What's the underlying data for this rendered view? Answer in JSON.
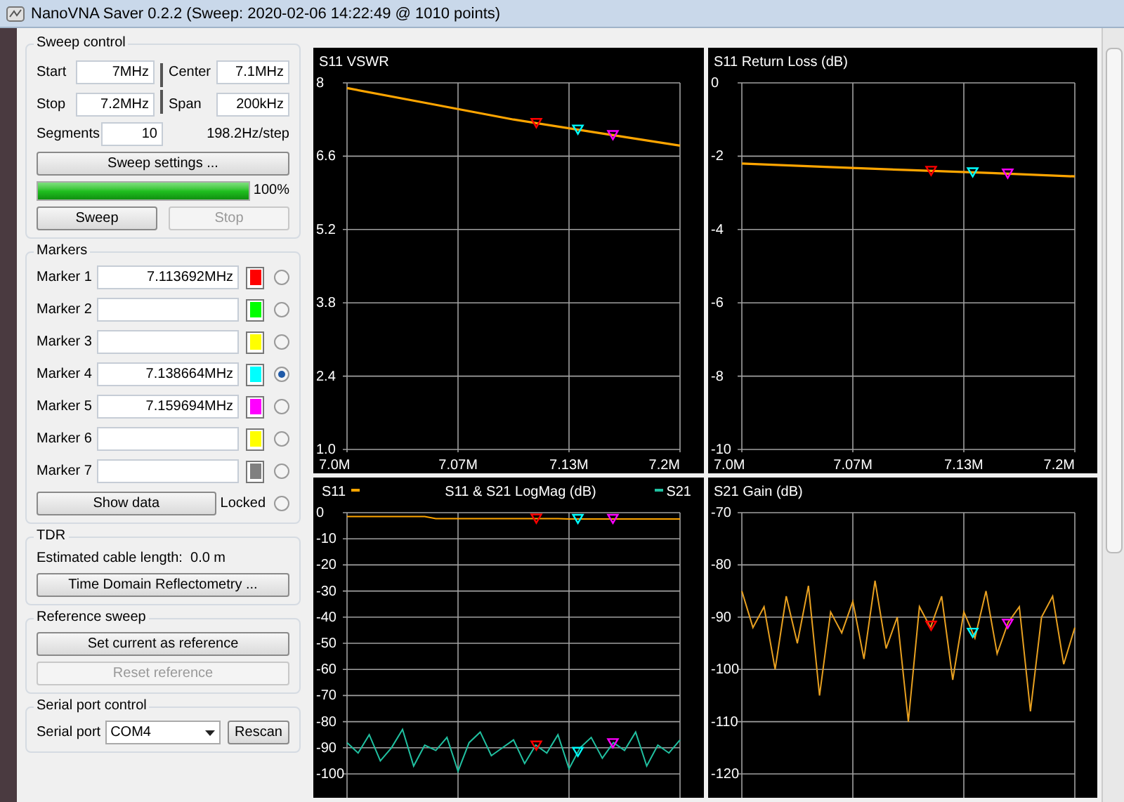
{
  "window": {
    "title": "NanoVNA Saver 0.2.2 (Sweep: 2020-02-06 14:22:49 @ 1010 points)"
  },
  "sweep_control": {
    "title": "Sweep control",
    "fields": [
      {
        "label": "Start",
        "value": "7MHz"
      },
      {
        "label": "Center",
        "value": "7.1MHz"
      },
      {
        "label": "Stop",
        "value": "7.2MHz"
      },
      {
        "label": "Span",
        "value": "200kHz"
      }
    ],
    "segments_label": "Segments",
    "segments": "10",
    "step": "198.2Hz/step",
    "settings_button": "Sweep settings ...",
    "progress": {
      "level": 1,
      "reading": "100%"
    },
    "buttons": [
      {
        "label": "Sweep",
        "disabled": false
      },
      {
        "label": "Stop",
        "disabled": true
      }
    ]
  },
  "markers": {
    "title": "Markers",
    "items": [
      {
        "label": "Marker 1",
        "value": "7.113692MHz",
        "color": "#ff0000",
        "selected": false
      },
      {
        "label": "Marker 2",
        "value": "",
        "color": "#00ff00",
        "selected": false
      },
      {
        "label": "Marker 3",
        "value": "",
        "color": "#ffff00",
        "selected": false
      },
      {
        "label": "Marker 4",
        "value": "7.138664MHz",
        "color": "#00ffff",
        "selected": true
      },
      {
        "label": "Marker 5",
        "value": "7.159694MHz",
        "color": "#ff00ff",
        "selected": false
      },
      {
        "label": "Marker 6",
        "value": "",
        "color": "#ffff00",
        "selected": false
      },
      {
        "label": "Marker 7",
        "value": "",
        "color": "#808080",
        "selected": false
      }
    ],
    "show_data": "Show data",
    "locked": {
      "label": "Locked",
      "checked": false
    }
  },
  "tdr": {
    "title": "TDR",
    "cable_length": "Estimated cable length:  0.0 m",
    "button": "Time Domain Reflectometry ..."
  },
  "reference_sweep": {
    "title": "Reference sweep",
    "buttons": [
      {
        "label": "Set current as reference",
        "disabled": false
      },
      {
        "label": "Reset reference",
        "disabled": true
      }
    ]
  },
  "serial_port": {
    "title": "Serial port control",
    "label": "Serial port",
    "value": "COM4",
    "button": "Rescan"
  },
  "charts": [
    {
      "kind": "line",
      "chart_data": {
        "type": "line",
        "title": "S11 VSWR",
        "x": [
          7.0,
          7.05,
          7.1,
          7.15,
          7.2
        ],
        "series": [
          {
            "color": "#ffa500",
            "values": [
              7.9,
              7.6,
              7.3,
              7.05,
              6.8
            ]
          }
        ],
        "xlim": [
          7.0,
          7.2
        ],
        "ylim": [
          1.0,
          8.0
        ],
        "grid": true,
        "xticks": [
          {
            "value": 7.0,
            "label": "7.0M"
          },
          {
            "value": 7.0667,
            "label": "7.07M"
          },
          {
            "value": 7.1333,
            "label": "7.13M"
          },
          {
            "value": 7.2,
            "label": "7.2M"
          }
        ],
        "yticks": [
          {
            "value": 1,
            "label": "1.0"
          },
          2.4,
          3.8,
          5.2,
          6.6,
          8
        ]
      }
    },
    {
      "kind": "line",
      "chart_data": {
        "type": "line",
        "title": "S11 Return Loss (dB)",
        "x": [
          7.0,
          7.05,
          7.1,
          7.15,
          7.2
        ],
        "series": [
          {
            "color": "#ffa500",
            "values": [
              -2.2,
              -2.29,
              -2.38,
              -2.46,
              -2.55
            ]
          }
        ],
        "xlim": [
          7.0,
          7.2
        ],
        "ylim": [
          -10,
          0
        ],
        "grid": true,
        "xticks": [
          {
            "value": 7.0,
            "label": "7.0M"
          },
          {
            "value": 7.0667,
            "label": "7.07M"
          },
          {
            "value": 7.1333,
            "label": "7.13M"
          },
          {
            "value": 7.2,
            "label": "7.2M"
          }
        ],
        "yticks": [
          0,
          -2,
          -4,
          -6,
          -8,
          -10
        ]
      }
    },
    {
      "kind": "line",
      "chart_data": {
        "type": "line",
        "title": "S11 & S21 LogMag (dB)",
        "legend": "top",
        "x": [
          7.0,
          7.0067,
          7.0133,
          7.02,
          7.0267,
          7.0333,
          7.04,
          7.0467,
          7.0533,
          7.06,
          7.0667,
          7.0733,
          7.08,
          7.0867,
          7.0933,
          7.1,
          7.1067,
          7.1133,
          7.12,
          7.1267,
          7.1333,
          7.14,
          7.1467,
          7.1533,
          7.16,
          7.1667,
          7.1733,
          7.18,
          7.1867,
          7.1933,
          7.2
        ],
        "series": [
          {
            "name": "S11",
            "color": "#ffa500",
            "values": [
              -1.5,
              -1.5,
              -1.5,
              -1.5,
              -1.5,
              -1.5,
              -1.5,
              -1.5,
              -2.3,
              -2.3,
              -2.3,
              -2.3,
              -2.3,
              -2.3,
              -2.3,
              -2.3,
              -2.3,
              -2.3,
              -2.3,
              -2.3,
              -2.4,
              -2.4,
              -2.4,
              -2.4,
              -2.4,
              -2.4,
              -2.4,
              -2.4,
              -2.4,
              -2.4,
              -2.4
            ]
          },
          {
            "name": "S21",
            "color": "#20c0a0",
            "values": [
              -88,
              -92,
              -85,
              -95,
              -90,
              -83,
              -97,
              -89,
              -91,
              -86,
              -99,
              -88,
              -84,
              -93,
              -90,
              -87,
              -96,
              -89,
              -92,
              -85,
              -98,
              -90,
              -86,
              -94,
              -88,
              -91,
              -84,
              -97,
              -89,
              -92,
              -87
            ]
          }
        ],
        "xlim": [
          7.0,
          7.2
        ],
        "ylim": [
          -100,
          0
        ],
        "grid": true,
        "yticks": [
          0,
          -10,
          -20,
          -30,
          -40,
          -50,
          -60,
          -70,
          -80,
          -90,
          -100
        ]
      }
    },
    {
      "kind": "line",
      "chart_data": {
        "type": "line",
        "title": "S21 Gain (dB)",
        "x": [
          7.0,
          7.0067,
          7.0133,
          7.02,
          7.0267,
          7.0333,
          7.04,
          7.0467,
          7.0533,
          7.06,
          7.0667,
          7.0733,
          7.08,
          7.0867,
          7.0933,
          7.1,
          7.1067,
          7.1133,
          7.12,
          7.1267,
          7.1333,
          7.14,
          7.1467,
          7.1533,
          7.16,
          7.1667,
          7.1733,
          7.18,
          7.1867,
          7.1933,
          7.2
        ],
        "series": [
          {
            "color": "#e8a020",
            "values": [
              -85,
              -92,
              -88,
              -100,
              -86,
              -95,
              -84,
              -105,
              -89,
              -93,
              -87,
              -98,
              -83,
              -96,
              -90,
              -110,
              -88,
              -92,
              -86,
              -102,
              -89,
              -94,
              -85,
              -97,
              -91,
              -88,
              -108,
              -90,
              -86,
              -99,
              -92
            ]
          }
        ],
        "xlim": [
          7.0,
          7.2
        ],
        "ylim": [
          -120,
          -70
        ],
        "grid": true,
        "yticks": [
          -70,
          -80,
          -90,
          -100,
          -110,
          -120
        ]
      }
    }
  ]
}
